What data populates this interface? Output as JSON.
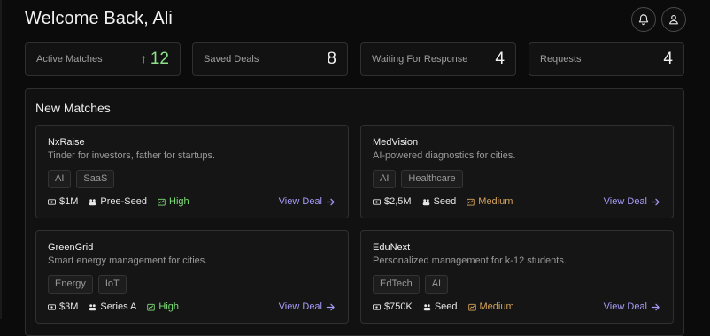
{
  "header": {
    "title": "Welcome Back, Ali"
  },
  "stats": [
    {
      "label": "Active Matches",
      "value": "12",
      "trend": "up"
    },
    {
      "label": "Saved Deals",
      "value": "8"
    },
    {
      "label": "Waiting For Response",
      "value": "4"
    },
    {
      "label": "Requests",
      "value": "4"
    }
  ],
  "new_matches": {
    "title": "New Matches",
    "view_label": "View Deal",
    "deals": [
      {
        "name": "NxRaise",
        "description": "Tinder for investors, father for startups.",
        "tags": [
          "AI",
          "SaaS"
        ],
        "amount": "$1M",
        "stage": "Pree-Seed",
        "potential": "High"
      },
      {
        "name": "MedVision",
        "description": "AI-powered diagnostics for cities.",
        "tags": [
          "AI",
          "Healthcare"
        ],
        "amount": "$2,5M",
        "stage": "Seed",
        "potential": "Medium"
      },
      {
        "name": "GreenGrid",
        "description": "Smart energy management for cities.",
        "tags": [
          "Energy",
          "IoT"
        ],
        "amount": "$3M",
        "stage": "Series A",
        "potential": "High"
      },
      {
        "name": "EduNext",
        "description": "Personalized management for k-12 students.",
        "tags": [
          "EdTech",
          "AI"
        ],
        "amount": "$750K",
        "stage": "Seed",
        "potential": "Medium"
      }
    ]
  },
  "colors": {
    "trend_up": "#8ee08a",
    "high": "#7fdd79",
    "medium": "#d5a35b",
    "link": "#a69cf7"
  }
}
